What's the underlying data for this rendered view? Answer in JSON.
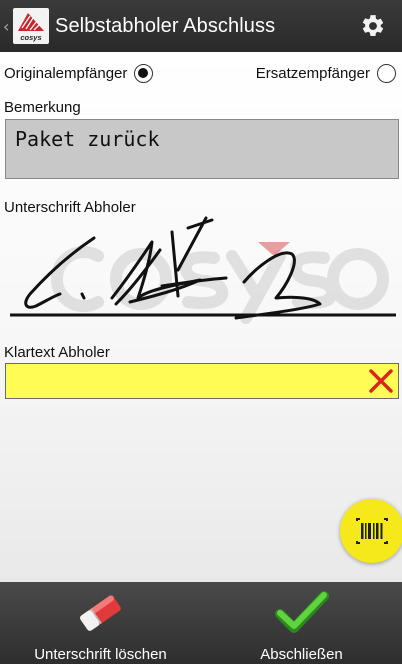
{
  "header": {
    "title": "Selbstabholer Abschluss",
    "logo_text": "cosys"
  },
  "recipient": {
    "original_label": "Originalempfänger",
    "original_selected": true,
    "substitute_label": "Ersatzempfänger",
    "substitute_selected": false
  },
  "remark": {
    "label": "Bemerkung",
    "value": "Paket zurück"
  },
  "signature": {
    "label": "Unterschrift Abholer",
    "watermark": "cosys"
  },
  "cleartext": {
    "label": "Klartext Abholer",
    "value": ""
  },
  "bottom": {
    "clear_signature_label": "Unterschrift löschen",
    "finish_label": "Abschließen"
  },
  "colors": {
    "input_highlight": "#fffc55",
    "clear_x": "#e0201b",
    "fab": "#f5e91b",
    "finish_check": "#3fb92a"
  },
  "icons": {
    "settings": "gear-icon",
    "clear": "close-icon",
    "scan": "barcode-icon",
    "erase": "eraser-icon",
    "finish": "checkmark-icon"
  }
}
